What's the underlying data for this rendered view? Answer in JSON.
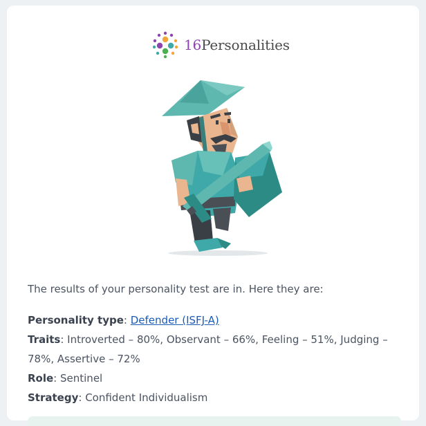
{
  "brand": {
    "name_prefix": "16",
    "name_suffix": "Personalities"
  },
  "illustration": {
    "icon": "defender-character-illustration"
  },
  "message": {
    "intro": "The results of your personality test are in. Here they are:",
    "personality_type_label": "Personality type",
    "personality_type_value": "Defender (ISFJ-A)",
    "traits_label": "Traits",
    "traits_value": "Introverted – 80%, Observant – 66%, Feeling – 51%, Judging – 78%, Assertive – 72%",
    "role_label": "Role",
    "role_value": "Sentinel",
    "strategy_label": "Strategy",
    "strategy_value": "Confident Individualism"
  },
  "colors": {
    "link": "#1a5bb8",
    "teal": "#3ea9a8",
    "background": "#eef1f4"
  }
}
